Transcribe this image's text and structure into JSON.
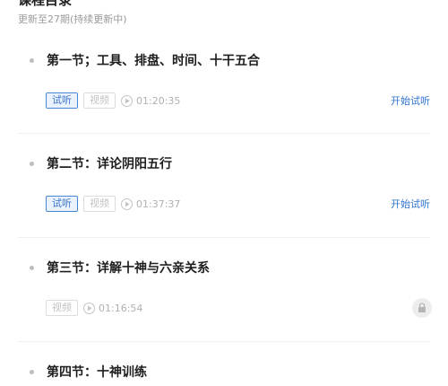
{
  "header": {
    "title": "课程目录",
    "update_note": "更新至27期(持续更新中)"
  },
  "lessons": [
    {
      "title": "第一节；工具、排盘、时间、十干五合",
      "trial_tag": "试听",
      "video_tag": "视频",
      "duration": "01:20:35",
      "action": "开始试听",
      "locked": false
    },
    {
      "title": "第二节：详论阴阳五行",
      "trial_tag": "试听",
      "video_tag": "视频",
      "duration": "01:37:37",
      "action": "开始试听",
      "locked": false
    },
    {
      "title": "第三节：详解十神与六亲关系",
      "video_tag": "视频",
      "duration": "01:16:54",
      "locked": true
    },
    {
      "title": "第四节：十神训练"
    }
  ],
  "colors": {
    "accent": "#2f74d0",
    "trial_border": "#4a86d6",
    "muted": "#b0b0b0"
  },
  "icons": {
    "bullet": "dot-icon",
    "play": "play-circle-icon",
    "lock": "lock-icon"
  }
}
